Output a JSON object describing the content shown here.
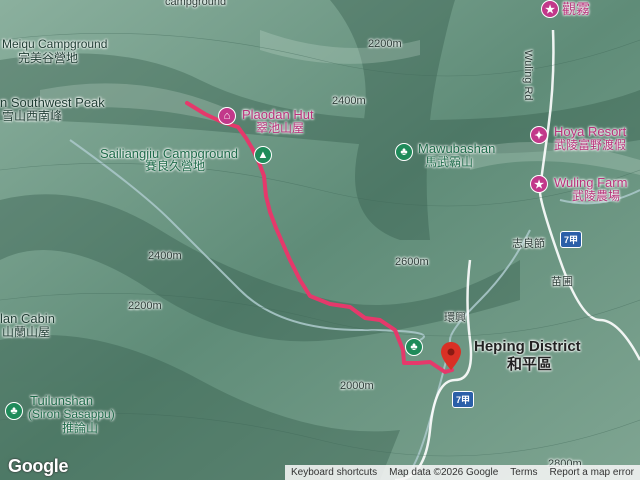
{
  "map": {
    "labels": {
      "campground_top": "campground",
      "guanwu": "觀霧",
      "meiqu_en": "Meiqu Campground",
      "meiqu_zh": "完美谷營地",
      "southwest_peak_en": "n Southwest Peak",
      "southwest_peak_zh": "雪山西南峰",
      "plaodan_en": "Plaodan Hut",
      "plaodan_zh": "翠池山屋",
      "sailiangjiu_en": "Sailiangjiu Campground",
      "sailiangjiu_zh": "賽良久營地",
      "mawubashan_en": "Mawubashan",
      "mawubashan_zh": "馬武霸山",
      "hoya_en": "Hoya Resort",
      "hoya_zh": "武陵富野渡假",
      "wuling_farm_en": "Wuling Farm",
      "wuling_farm_zh": "武陵農場",
      "wuling_rd": "Wuling Rd",
      "zhiliangjie": "志良節",
      "miaopu": "苗圃",
      "huanxing": "環興",
      "heping_en": "Heping District",
      "heping_zh": "和平區",
      "lan_cabin_en": "lan Cabin",
      "lan_cabin_zh": "山蘭山屋",
      "tuilunshan_en": "Tuilunshan",
      "tuilunshan_alt": "(Siron Sasappu)",
      "tuilunshan_zh": "推論山"
    },
    "route_shields": [
      "7甲",
      "7甲"
    ],
    "contour_labels": [
      "2200m",
      "2400m",
      "2600m",
      "2200m",
      "2000m",
      "2400m",
      "2800m"
    ],
    "icons": {
      "lodging": "lodging-icon",
      "campground": "campground-icon",
      "peak": "peak-icon",
      "resort": "resort-icon",
      "farm": "farm-icon",
      "destination": "destination-pin-icon"
    },
    "colors": {
      "route": "#e5396b",
      "poi_pink": "#c2388a",
      "poi_green": "#1f8b5a",
      "road": "#ffffff",
      "shield": "#2b5fa8"
    }
  },
  "attribution": {
    "brand": "Google",
    "keyboard": "Keyboard shortcuts",
    "map_data": "Map data ©2026 Google",
    "terms": "Terms",
    "report": "Report a map error"
  }
}
